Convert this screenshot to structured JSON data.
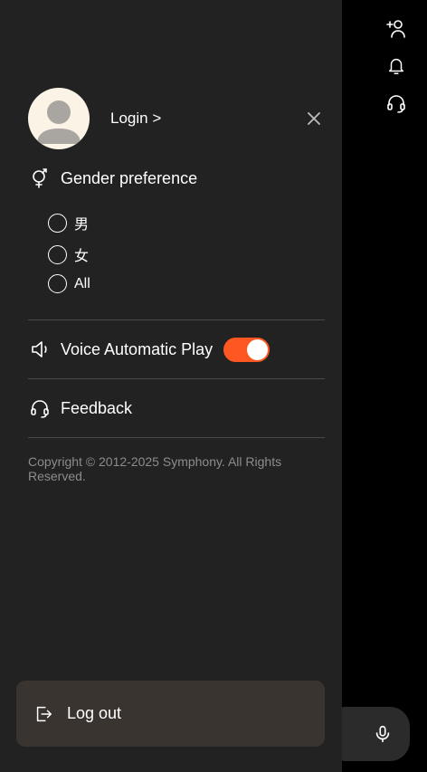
{
  "drawer": {
    "login_label": "Login >",
    "gender": {
      "label": "Gender preference",
      "options": [
        "男",
        "女",
        "All"
      ]
    },
    "voice": {
      "label": "Voice Automatic Play",
      "enabled": true
    },
    "feedback_label": "Feedback",
    "copyright": "Copyright © 2012-2025 Symphony. All Rights Reserved.",
    "logout_label": "Log out"
  },
  "top_icons": [
    "add-user-icon",
    "bell-icon",
    "headset-icon"
  ],
  "bottom": {
    "mic_icon": "microphone-icon"
  },
  "colors": {
    "drawer_bg": "#222222",
    "accent": "#ff5722",
    "logout_bg": "#3a3431",
    "avatar_bg": "#fbf3e6"
  }
}
